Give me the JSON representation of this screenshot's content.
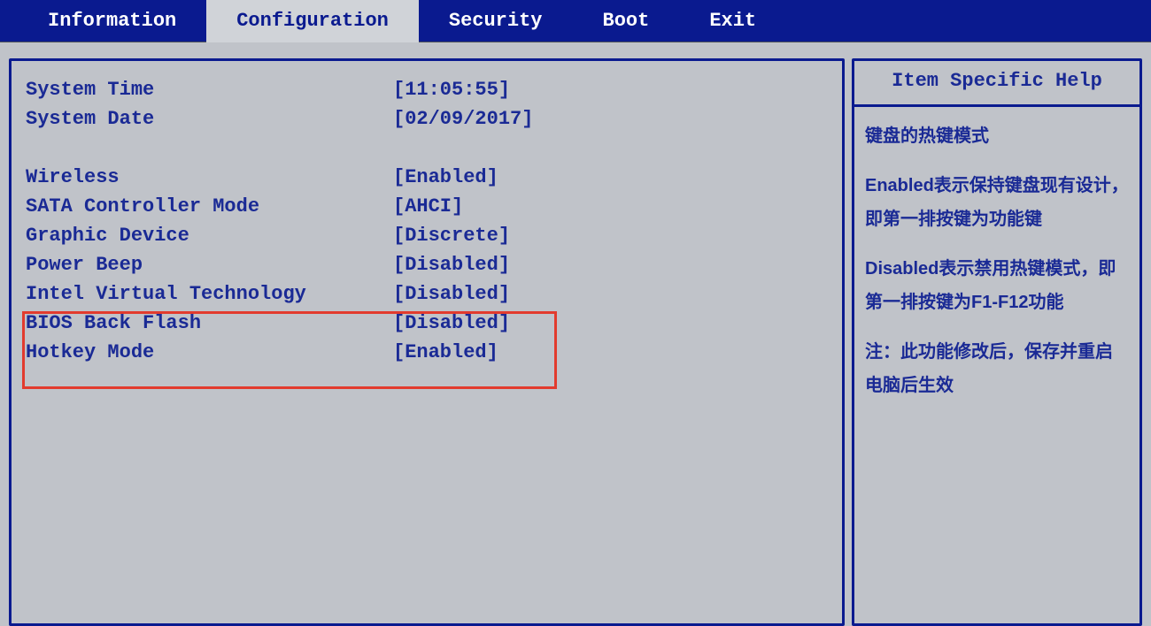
{
  "tabs": {
    "items": [
      {
        "label": "Information",
        "active": false
      },
      {
        "label": "Configuration",
        "active": true
      },
      {
        "label": "Security",
        "active": false
      },
      {
        "label": "Boot",
        "active": false
      },
      {
        "label": "Exit",
        "active": false
      }
    ]
  },
  "config": {
    "rows": [
      {
        "label": "System Time",
        "value": "[11:05:55]"
      },
      {
        "label": "System Date",
        "value": "[02/09/2017]"
      }
    ],
    "rows2": [
      {
        "label": "Wireless",
        "value": "[Enabled]"
      },
      {
        "label": "SATA Controller Mode",
        "value": "[AHCI]"
      },
      {
        "label": "Graphic Device",
        "value": "[Discrete]"
      },
      {
        "label": "Power Beep",
        "value": "[Disabled]"
      },
      {
        "label": "Intel Virtual Technology",
        "value": "[Disabled]"
      },
      {
        "label": "BIOS Back Flash",
        "value": "[Disabled]"
      },
      {
        "label": "Hotkey Mode",
        "value": "[Enabled]"
      }
    ]
  },
  "help": {
    "title": "Item Specific Help",
    "p1": "键盘的热键模式",
    "p2": "Enabled表示保持键盘现有设计，即第一排按键为功能键",
    "p3": "Disabled表示禁用热键模式，即第一排按键为F1-F12功能",
    "p4": "注：此功能修改后，保存并重启电脑后生效"
  }
}
